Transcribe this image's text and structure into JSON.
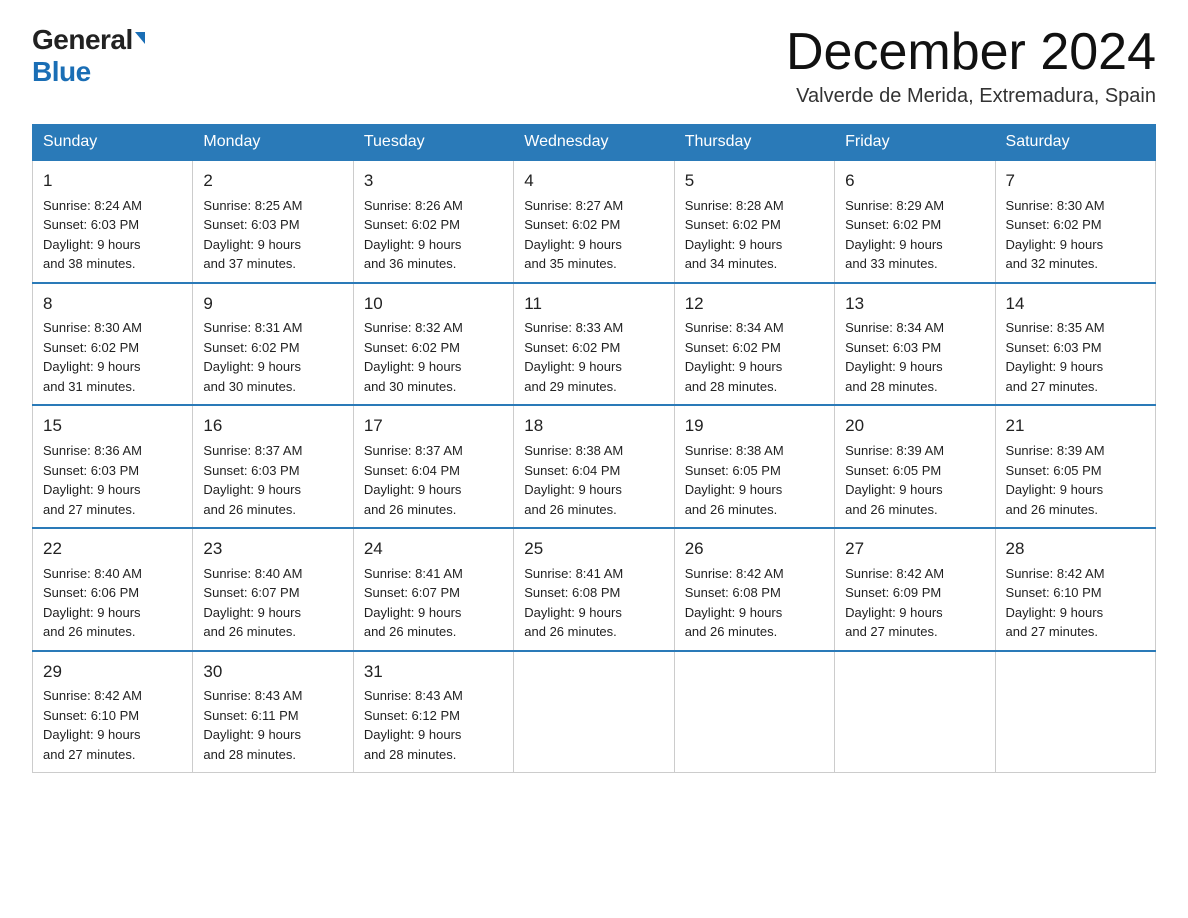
{
  "header": {
    "logo_general": "General",
    "logo_blue": "Blue",
    "month_title": "December 2024",
    "location": "Valverde de Merida, Extremadura, Spain"
  },
  "weekdays": [
    "Sunday",
    "Monday",
    "Tuesday",
    "Wednesday",
    "Thursday",
    "Friday",
    "Saturday"
  ],
  "weeks": [
    [
      {
        "day": "1",
        "info": "Sunrise: 8:24 AM\nSunset: 6:03 PM\nDaylight: 9 hours\nand 38 minutes."
      },
      {
        "day": "2",
        "info": "Sunrise: 8:25 AM\nSunset: 6:03 PM\nDaylight: 9 hours\nand 37 minutes."
      },
      {
        "day": "3",
        "info": "Sunrise: 8:26 AM\nSunset: 6:02 PM\nDaylight: 9 hours\nand 36 minutes."
      },
      {
        "day": "4",
        "info": "Sunrise: 8:27 AM\nSunset: 6:02 PM\nDaylight: 9 hours\nand 35 minutes."
      },
      {
        "day": "5",
        "info": "Sunrise: 8:28 AM\nSunset: 6:02 PM\nDaylight: 9 hours\nand 34 minutes."
      },
      {
        "day": "6",
        "info": "Sunrise: 8:29 AM\nSunset: 6:02 PM\nDaylight: 9 hours\nand 33 minutes."
      },
      {
        "day": "7",
        "info": "Sunrise: 8:30 AM\nSunset: 6:02 PM\nDaylight: 9 hours\nand 32 minutes."
      }
    ],
    [
      {
        "day": "8",
        "info": "Sunrise: 8:30 AM\nSunset: 6:02 PM\nDaylight: 9 hours\nand 31 minutes."
      },
      {
        "day": "9",
        "info": "Sunrise: 8:31 AM\nSunset: 6:02 PM\nDaylight: 9 hours\nand 30 minutes."
      },
      {
        "day": "10",
        "info": "Sunrise: 8:32 AM\nSunset: 6:02 PM\nDaylight: 9 hours\nand 30 minutes."
      },
      {
        "day": "11",
        "info": "Sunrise: 8:33 AM\nSunset: 6:02 PM\nDaylight: 9 hours\nand 29 minutes."
      },
      {
        "day": "12",
        "info": "Sunrise: 8:34 AM\nSunset: 6:02 PM\nDaylight: 9 hours\nand 28 minutes."
      },
      {
        "day": "13",
        "info": "Sunrise: 8:34 AM\nSunset: 6:03 PM\nDaylight: 9 hours\nand 28 minutes."
      },
      {
        "day": "14",
        "info": "Sunrise: 8:35 AM\nSunset: 6:03 PM\nDaylight: 9 hours\nand 27 minutes."
      }
    ],
    [
      {
        "day": "15",
        "info": "Sunrise: 8:36 AM\nSunset: 6:03 PM\nDaylight: 9 hours\nand 27 minutes."
      },
      {
        "day": "16",
        "info": "Sunrise: 8:37 AM\nSunset: 6:03 PM\nDaylight: 9 hours\nand 26 minutes."
      },
      {
        "day": "17",
        "info": "Sunrise: 8:37 AM\nSunset: 6:04 PM\nDaylight: 9 hours\nand 26 minutes."
      },
      {
        "day": "18",
        "info": "Sunrise: 8:38 AM\nSunset: 6:04 PM\nDaylight: 9 hours\nand 26 minutes."
      },
      {
        "day": "19",
        "info": "Sunrise: 8:38 AM\nSunset: 6:05 PM\nDaylight: 9 hours\nand 26 minutes."
      },
      {
        "day": "20",
        "info": "Sunrise: 8:39 AM\nSunset: 6:05 PM\nDaylight: 9 hours\nand 26 minutes."
      },
      {
        "day": "21",
        "info": "Sunrise: 8:39 AM\nSunset: 6:05 PM\nDaylight: 9 hours\nand 26 minutes."
      }
    ],
    [
      {
        "day": "22",
        "info": "Sunrise: 8:40 AM\nSunset: 6:06 PM\nDaylight: 9 hours\nand 26 minutes."
      },
      {
        "day": "23",
        "info": "Sunrise: 8:40 AM\nSunset: 6:07 PM\nDaylight: 9 hours\nand 26 minutes."
      },
      {
        "day": "24",
        "info": "Sunrise: 8:41 AM\nSunset: 6:07 PM\nDaylight: 9 hours\nand 26 minutes."
      },
      {
        "day": "25",
        "info": "Sunrise: 8:41 AM\nSunset: 6:08 PM\nDaylight: 9 hours\nand 26 minutes."
      },
      {
        "day": "26",
        "info": "Sunrise: 8:42 AM\nSunset: 6:08 PM\nDaylight: 9 hours\nand 26 minutes."
      },
      {
        "day": "27",
        "info": "Sunrise: 8:42 AM\nSunset: 6:09 PM\nDaylight: 9 hours\nand 27 minutes."
      },
      {
        "day": "28",
        "info": "Sunrise: 8:42 AM\nSunset: 6:10 PM\nDaylight: 9 hours\nand 27 minutes."
      }
    ],
    [
      {
        "day": "29",
        "info": "Sunrise: 8:42 AM\nSunset: 6:10 PM\nDaylight: 9 hours\nand 27 minutes."
      },
      {
        "day": "30",
        "info": "Sunrise: 8:43 AM\nSunset: 6:11 PM\nDaylight: 9 hours\nand 28 minutes."
      },
      {
        "day": "31",
        "info": "Sunrise: 8:43 AM\nSunset: 6:12 PM\nDaylight: 9 hours\nand 28 minutes."
      },
      null,
      null,
      null,
      null
    ]
  ]
}
